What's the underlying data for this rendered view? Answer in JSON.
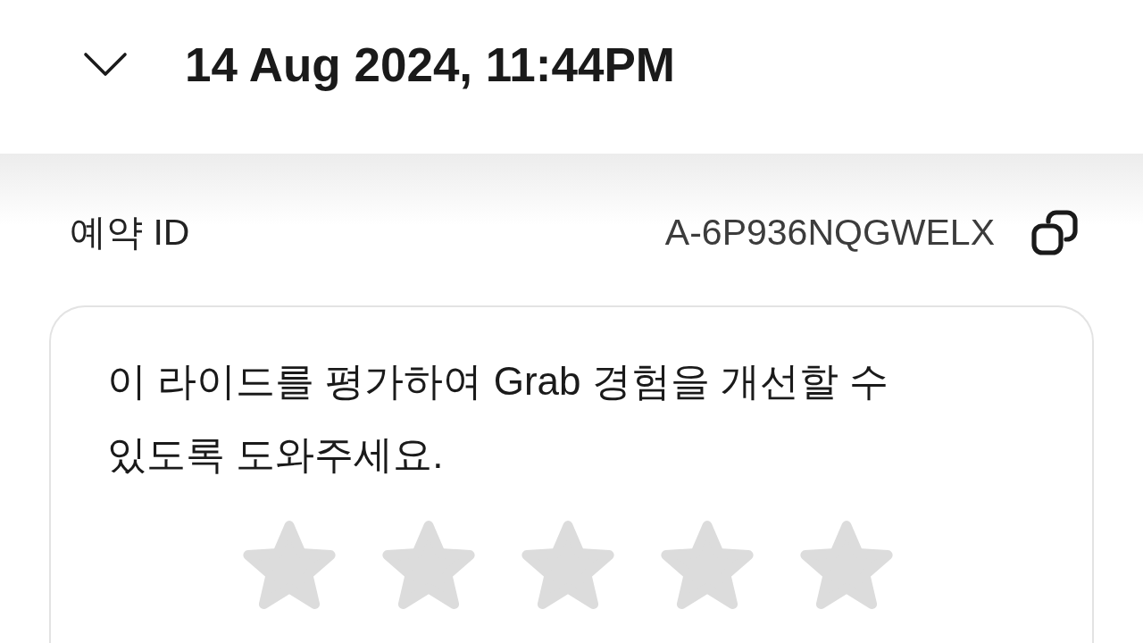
{
  "header": {
    "title": "14 Aug 2024, 11:44PM"
  },
  "booking": {
    "label": "예약 ID",
    "value": "A-6P936NQGWELX"
  },
  "rating": {
    "prompt": "이 라이드를 평가하여 Grab 경험을 개선할 수 있도록 도와주세요.",
    "stars": 0
  }
}
